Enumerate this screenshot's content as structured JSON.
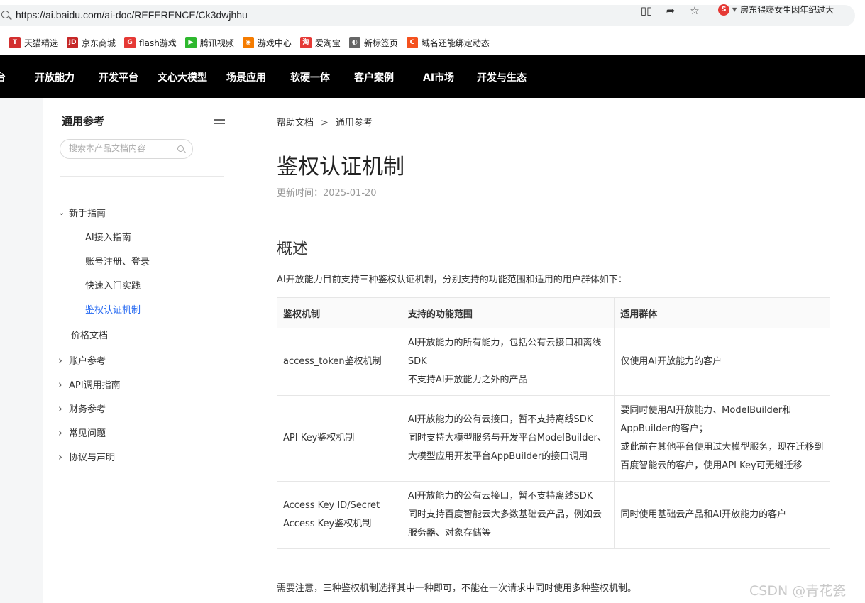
{
  "browser": {
    "url": "https://ai.baidu.com/ai-doc/REFERENCE/Ck3dwjhhu",
    "toolbar_icons": [
      "reader-mode-icon",
      "share-icon",
      "bookmark-star-icon"
    ],
    "extension_news": "房东猥亵女生因年纪过大"
  },
  "bookmarks": [
    {
      "label": "天猫精选",
      "icon": "tmall-icon",
      "color": "#d32f2f",
      "glyph": "T"
    },
    {
      "label": "京东商城",
      "icon": "jd-icon",
      "color": "#c62828",
      "glyph": "JD"
    },
    {
      "label": "flash游戏",
      "icon": "flash-game-icon",
      "color": "#e53935",
      "glyph": "G"
    },
    {
      "label": "腾讯视频",
      "icon": "tencent-video-icon",
      "color": "#2eb82e",
      "glyph": "▶"
    },
    {
      "label": "游戏中心",
      "icon": "game-center-icon",
      "color": "#f57c00",
      "glyph": "◉"
    },
    {
      "label": "爱淘宝",
      "icon": "aitaobao-icon",
      "color": "#e53935",
      "glyph": "淘"
    },
    {
      "label": "新标签页",
      "icon": "new-tab-icon",
      "color": "#666666",
      "glyph": "◐"
    },
    {
      "label": "域名还能绑定动态",
      "icon": "domain-icon",
      "color": "#f4511e",
      "glyph": "C"
    }
  ],
  "topnav": {
    "left_fragment": "台",
    "items": [
      "开放能力",
      "开发平台",
      "文心大模型",
      "场景应用",
      "软硬一体",
      "客户案例",
      "AI市场",
      "开发与生态"
    ]
  },
  "sidebar": {
    "title": "通用参考",
    "search_placeholder": "搜索本产品文档内容",
    "items": [
      {
        "label": "新手指南",
        "level": 0,
        "expand": "down"
      },
      {
        "label": "AI接入指南",
        "level": 1
      },
      {
        "label": "账号注册、登录",
        "level": 1
      },
      {
        "label": "快速入门实践",
        "level": 1
      },
      {
        "label": "鉴权认证机制",
        "level": 1,
        "active": true
      },
      {
        "label": "价格文档",
        "level": 0,
        "expand": "none"
      },
      {
        "label": "账户参考",
        "level": 0,
        "expand": "right"
      },
      {
        "label": "API调用指南",
        "level": 0,
        "expand": "right"
      },
      {
        "label": "财务参考",
        "level": 0,
        "expand": "right"
      },
      {
        "label": "常见问题",
        "level": 0,
        "expand": "right"
      },
      {
        "label": "协议与声明",
        "level": 0,
        "expand": "right"
      }
    ]
  },
  "main": {
    "breadcrumb": [
      "帮助文档",
      "通用参考"
    ],
    "breadcrumb_sep": ">",
    "title": "鉴权认证机制",
    "updated": "更新时间：2025-01-20",
    "section_title": "概述",
    "intro": "AI开放能力目前支持三种鉴权认证机制，分别支持的功能范围和适用的用户群体如下：",
    "table": {
      "headers": [
        "鉴权机制",
        "支持的功能范围",
        "适用群体"
      ],
      "rows": [
        [
          [
            "access_token鉴权机制"
          ],
          [
            "AI开放能力的所有能力，包括公有云接口和离线SDK",
            "不支持AI开放能力之外的产品"
          ],
          [
            "仅使用AI开放能力的客户"
          ]
        ],
        [
          [
            "API Key鉴权机制"
          ],
          [
            "AI开放能力的公有云接口，暂不支持离线SDK",
            "同时支持大模型服务与开发平台ModelBuilder、大模型应用开发平台AppBuilder的接口调用"
          ],
          [
            "要同时使用AI开放能力、ModelBuilder和AppBuilder的客户；",
            "或此前在其他平台使用过大模型服务，现在迁移到百度智能云的客户，使用API Key可无缝迁移"
          ]
        ],
        [
          [
            "Access Key ID/Secret",
            "Access Key鉴权机制"
          ],
          [
            "AI开放能力的公有云接口，暂不支持离线SDK",
            "同时支持百度智能云大多数基础云产品，例如云服务器、对象存储等"
          ],
          [
            "同时使用基础云产品和AI开放能力的客户"
          ]
        ]
      ]
    },
    "note": "需要注意，三种鉴权机制选择其中一种即可，不能在一次请求中同时使用多种鉴权机制。"
  },
  "watermark": "CSDN @青花瓷"
}
